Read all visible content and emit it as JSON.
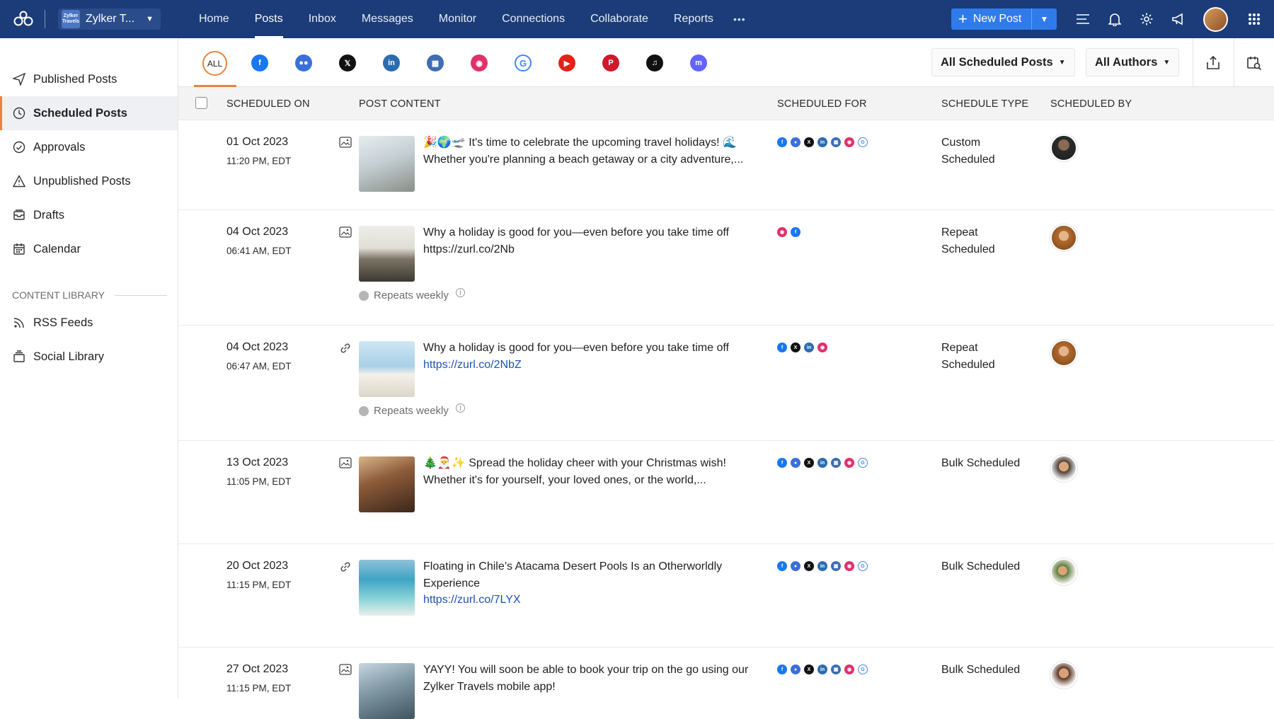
{
  "topbar": {
    "brand_name": "Zylker T...",
    "brand_logo_text": "Zylker Travels",
    "nav": [
      "Home",
      "Posts",
      "Inbox",
      "Messages",
      "Monitor",
      "Connections",
      "Collaborate",
      "Reports"
    ],
    "nav_active": "Posts",
    "more": "•••",
    "new_post_label": "New Post"
  },
  "sidebar": {
    "items": [
      {
        "label": "Published Posts",
        "icon": "send-icon"
      },
      {
        "label": "Scheduled Posts",
        "icon": "clock-icon",
        "active": true
      },
      {
        "label": "Approvals",
        "icon": "check-circle-icon"
      },
      {
        "label": "Unpublished Posts",
        "icon": "warning-icon"
      },
      {
        "label": "Drafts",
        "icon": "drafts-icon"
      },
      {
        "label": "Calendar",
        "icon": "calendar-icon"
      }
    ],
    "section_title": "CONTENT LIBRARY",
    "library_items": [
      {
        "label": "RSS Feeds",
        "icon": "rss-icon"
      },
      {
        "label": "Social Library",
        "icon": "library-icon"
      }
    ]
  },
  "filters": {
    "all_label": "ALL",
    "networks": [
      "facebook",
      "facebook-groups",
      "x",
      "linkedin",
      "linkedin-page",
      "instagram",
      "google-business",
      "youtube",
      "pinterest",
      "tiktok",
      "mastodon"
    ],
    "scheduled_filter": "All Scheduled Posts",
    "author_filter": "All Authors"
  },
  "table": {
    "headers": {
      "scheduled_on": "SCHEDULED ON",
      "post_content": "POST CONTENT",
      "scheduled_for": "SCHEDULED FOR",
      "schedule_type": "SCHEDULE TYPE",
      "scheduled_by": "SCHEDULED BY"
    },
    "rows": [
      {
        "date": "01 Oct 2023",
        "time": "11:20 PM, EDT",
        "type": "image",
        "text": "🎉🌍🛫 It's time to celebrate the upcoming travel holidays! 🌊 Whether you're planning a beach getaway or a city adventure,...",
        "link": "",
        "repeat": "",
        "networks": [
          "facebook",
          "facebook-groups",
          "x",
          "linkedin",
          "linkedin-page",
          "instagram",
          "google-business"
        ],
        "schedule_type": "Custom Scheduled",
        "thumb": "#b9c7cf"
      },
      {
        "date": "04 Oct 2023",
        "time": "06:41 AM, EDT",
        "type": "image",
        "text": "Why a holiday is good for you—even before you take time off https://zurl.co/2Nb",
        "link": "",
        "repeat": "Repeats weekly",
        "networks": [
          "instagram",
          "facebook"
        ],
        "schedule_type": "Repeat Scheduled",
        "thumb": "#8f8a7e"
      },
      {
        "date": "04 Oct 2023",
        "time": "06:47 AM, EDT",
        "type": "link",
        "text": "Why a holiday is good for you—even before you take time off ",
        "link": "https://zurl.co/2NbZ",
        "repeat": "Repeats weekly",
        "networks": [
          "facebook",
          "x",
          "linkedin",
          "instagram"
        ],
        "schedule_type": "Repeat Scheduled",
        "thumb": "#b7d6ea"
      },
      {
        "date": "13 Oct 2023",
        "time": "11:05 PM, EDT",
        "type": "image",
        "text": "🎄🎅✨ Spread the holiday cheer with your Christmas wish! Whether it's for yourself, your loved ones, or the world,...",
        "link": "",
        "repeat": "",
        "networks": [
          "facebook",
          "facebook-groups",
          "x",
          "linkedin",
          "linkedin-page",
          "instagram",
          "google-business"
        ],
        "schedule_type": "Bulk Scheduled",
        "thumb": "#6b4a35"
      },
      {
        "date": "20 Oct 2023",
        "time": "11:15 PM, EDT",
        "type": "link",
        "text": "Floating in Chile’s Atacama Desert Pools Is an Otherworldly Experience ",
        "link": "https://zurl.co/7LYX",
        "repeat": "",
        "networks": [
          "facebook",
          "facebook-groups",
          "x",
          "linkedin",
          "linkedin-page",
          "instagram",
          "google-business"
        ],
        "schedule_type": "Bulk Scheduled",
        "thumb": "#3fa4c4"
      },
      {
        "date": "27 Oct 2023",
        "time": "11:15 PM, EDT",
        "type": "image",
        "text": "YAYY! You will soon be able to book your trip on the go using our Zylker Travels mobile app!",
        "link": "",
        "repeat": "",
        "networks": [
          "facebook",
          "facebook-groups",
          "x",
          "linkedin",
          "linkedin-page",
          "instagram",
          "google-business"
        ],
        "schedule_type": "Bulk Scheduled",
        "thumb": "#7f96a3"
      }
    ]
  },
  "colors": {
    "topbar": "#1b3c78",
    "accent": "#e9843d",
    "primary": "#2f7bea",
    "link": "#1d52b5",
    "facebook": "#1877f2",
    "facebook-groups": "#3b6fd9",
    "x": "#111111",
    "linkedin": "#2b6cb0",
    "linkedin-page": "#3d6eb5",
    "instagram": "#e1306c",
    "google-business": "#4285f4",
    "youtube": "#e62117",
    "pinterest": "#d1182b",
    "tiktok": "#111111",
    "mastodon": "#6364ff"
  }
}
